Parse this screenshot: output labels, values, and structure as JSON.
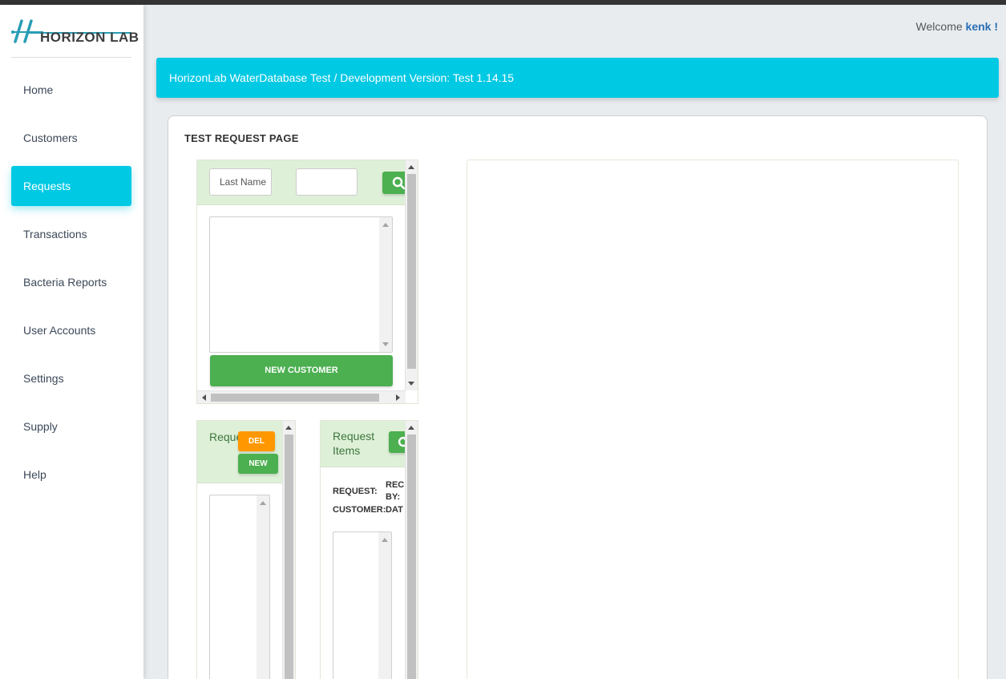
{
  "brand": {
    "logo_text": "HORIZON LAB"
  },
  "sidebar": {
    "items": [
      {
        "label": "Home",
        "active": false
      },
      {
        "label": "Customers",
        "active": false
      },
      {
        "label": "Requests",
        "active": true
      },
      {
        "label": "Transactions",
        "active": false
      },
      {
        "label": "Bacteria Reports",
        "active": false
      },
      {
        "label": "User Accounts",
        "active": false
      },
      {
        "label": "Settings",
        "active": false
      },
      {
        "label": "Supply",
        "active": false
      },
      {
        "label": "Help",
        "active": false
      }
    ]
  },
  "header": {
    "welcome_prefix": "Welcome",
    "username": "kenk !"
  },
  "banner": {
    "text": "HorizonLab WaterDatabase Test / Development Version: Test 1.14.15"
  },
  "page": {
    "title": "TEST REQUEST PAGE"
  },
  "customer_search": {
    "last_name_placeholder": "Last Name",
    "second_field_value": "",
    "search_icon": "search-icon",
    "new_customer_label": "NEW CUSTOMER"
  },
  "requests_panel": {
    "title": "Reque",
    "del_label": "DEL",
    "new_label": "NEW"
  },
  "request_items_panel": {
    "title_line1": "Request",
    "title_line2": "Items",
    "refresh_icon": "refresh-icon",
    "request_label": "REQUEST:",
    "customer_label": "CUSTOMER:",
    "rec_label": "REC",
    "by_label": "BY:",
    "dat_label": "DAT"
  },
  "colors": {
    "accent": "#00c9e4",
    "green": "#4caf50",
    "orange": "#ff9800",
    "panel_head": "#dff0d8"
  }
}
